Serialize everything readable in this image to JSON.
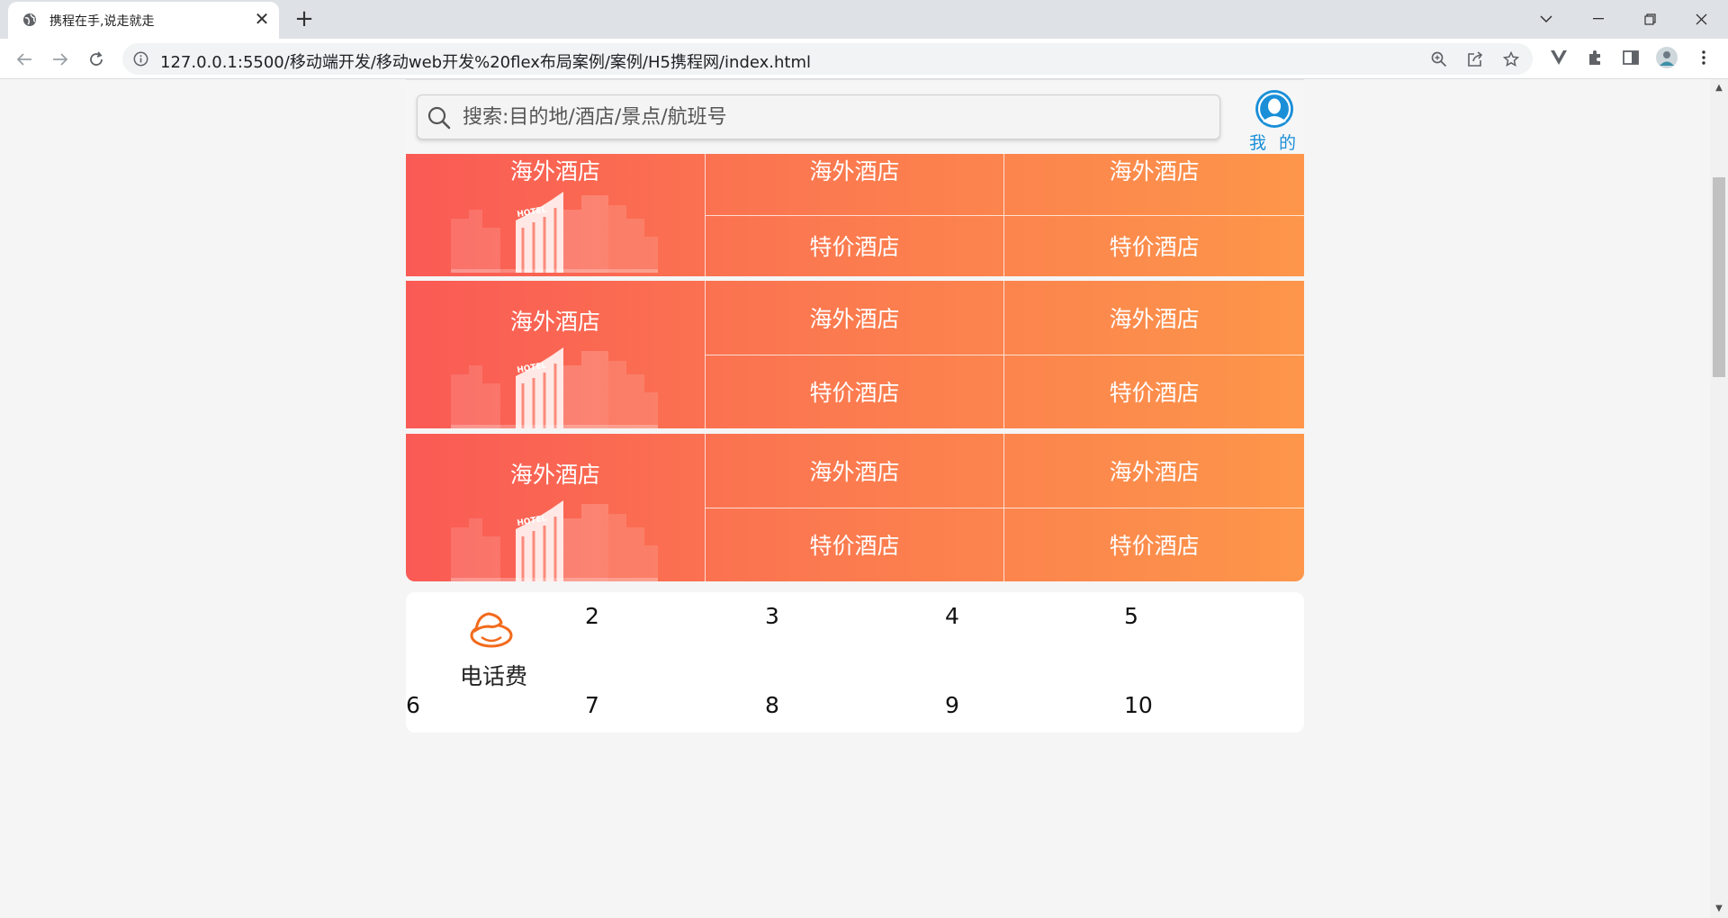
{
  "browser": {
    "tab_title": "携程在手,说走就走",
    "url": "127.0.0.1:5500/移动端开发/移动web开发%20flex布局案例/案例/H5携程网/index.html"
  },
  "search": {
    "placeholder": "搜索:目的地/酒店/景点/航班号"
  },
  "user": {
    "label": "我 的"
  },
  "hotel_rows": [
    {
      "main": "海外酒店",
      "cols": [
        {
          "top": "海外酒店",
          "bottom": "特价酒店"
        },
        {
          "top": "海外酒店",
          "bottom": "特价酒店"
        }
      ]
    },
    {
      "main": "海外酒店",
      "cols": [
        {
          "top": "海外酒店",
          "bottom": "特价酒店"
        },
        {
          "top": "海外酒店",
          "bottom": "特价酒店"
        }
      ]
    },
    {
      "main": "海外酒店",
      "cols": [
        {
          "top": "海外酒店",
          "bottom": "特价酒店"
        },
        {
          "top": "海外酒店",
          "bottom": "特价酒店"
        }
      ]
    }
  ],
  "hotel_art_label": "HOTEL",
  "sub_nav": {
    "first_label": "电话费",
    "items": [
      "2",
      "3",
      "4",
      "5",
      "6",
      "7",
      "8",
      "9",
      "10"
    ]
  },
  "colors": {
    "gradient_start": "#fa5a55",
    "gradient_end": "#fd964a",
    "user_blue": "#1a8fd8",
    "phone_orange": "#f26a1c"
  }
}
